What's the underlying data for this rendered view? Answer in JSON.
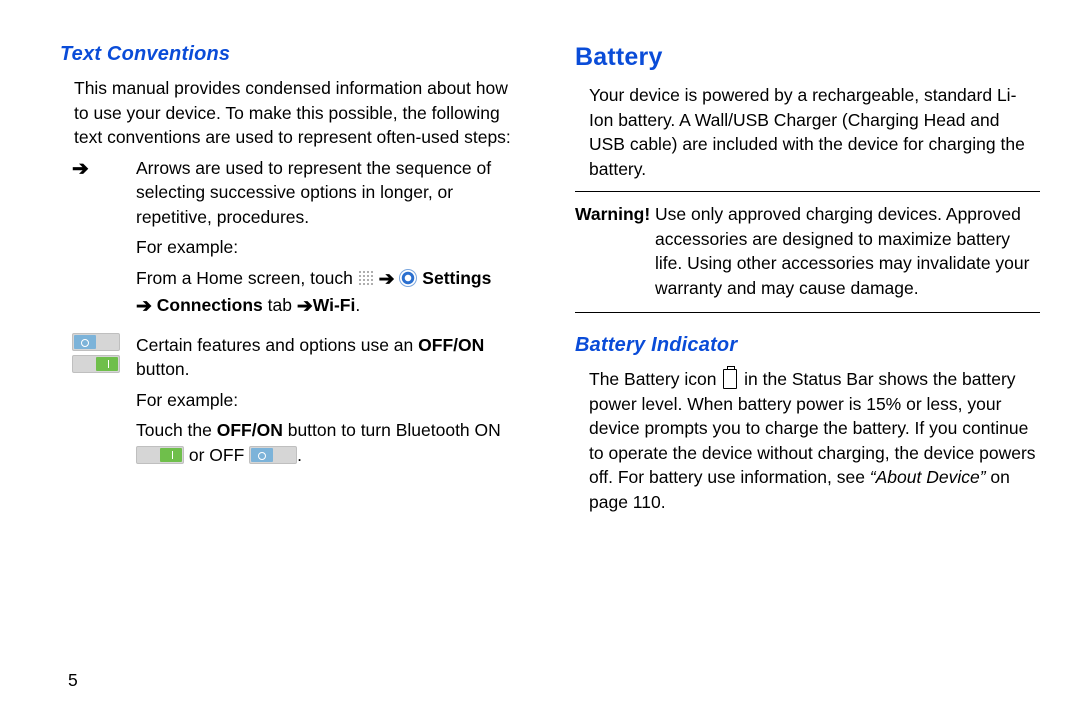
{
  "page_number": "5",
  "left": {
    "heading": "Text Conventions",
    "intro": "This manual provides condensed information about how to use your device. To make this possible, the following text conventions are used to represent often-used steps:",
    "arrow_item": {
      "desc": "Arrows are used to represent the sequence of selecting successive options in longer, or repetitive, procedures.",
      "for_example": "For example:",
      "ex_prefix": "From a Home screen, touch ",
      "settings": " Settings",
      "connections": " Connections",
      "tab": " tab ",
      "wifi": "Wi-Fi",
      "period": "."
    },
    "toggle_item": {
      "line1_a": "Certain features and options use an ",
      "offon": "OFF/ON",
      "line1_b": " button.",
      "for_example": "For example:",
      "line2_a": "Touch the ",
      "line2_b": " button to turn Bluetooth ON ",
      "or": " or OFF ",
      "period": "."
    }
  },
  "right": {
    "heading": "Battery",
    "para1": "Your device is powered by a rechargeable, standard Li-Ion battery. A Wall/USB Charger (Charging Head and USB cable) are included with the device for charging the battery.",
    "warning_label": "Warning!",
    "warning_body": " Use only approved charging devices. Approved accessories are designed to maximize battery life. Using other accessories may invalidate your warranty and may cause damage.",
    "sub_heading": "Battery Indicator",
    "bi_a": "The Battery icon ",
    "bi_b": " in the Status Bar shows the battery power level. When battery power is 15% or less, your device prompts you to charge the battery. If you continue to operate the device without charging, the device powers off. For battery use information, see ",
    "bi_link": "“About Device”",
    "bi_c": " on page 110."
  }
}
